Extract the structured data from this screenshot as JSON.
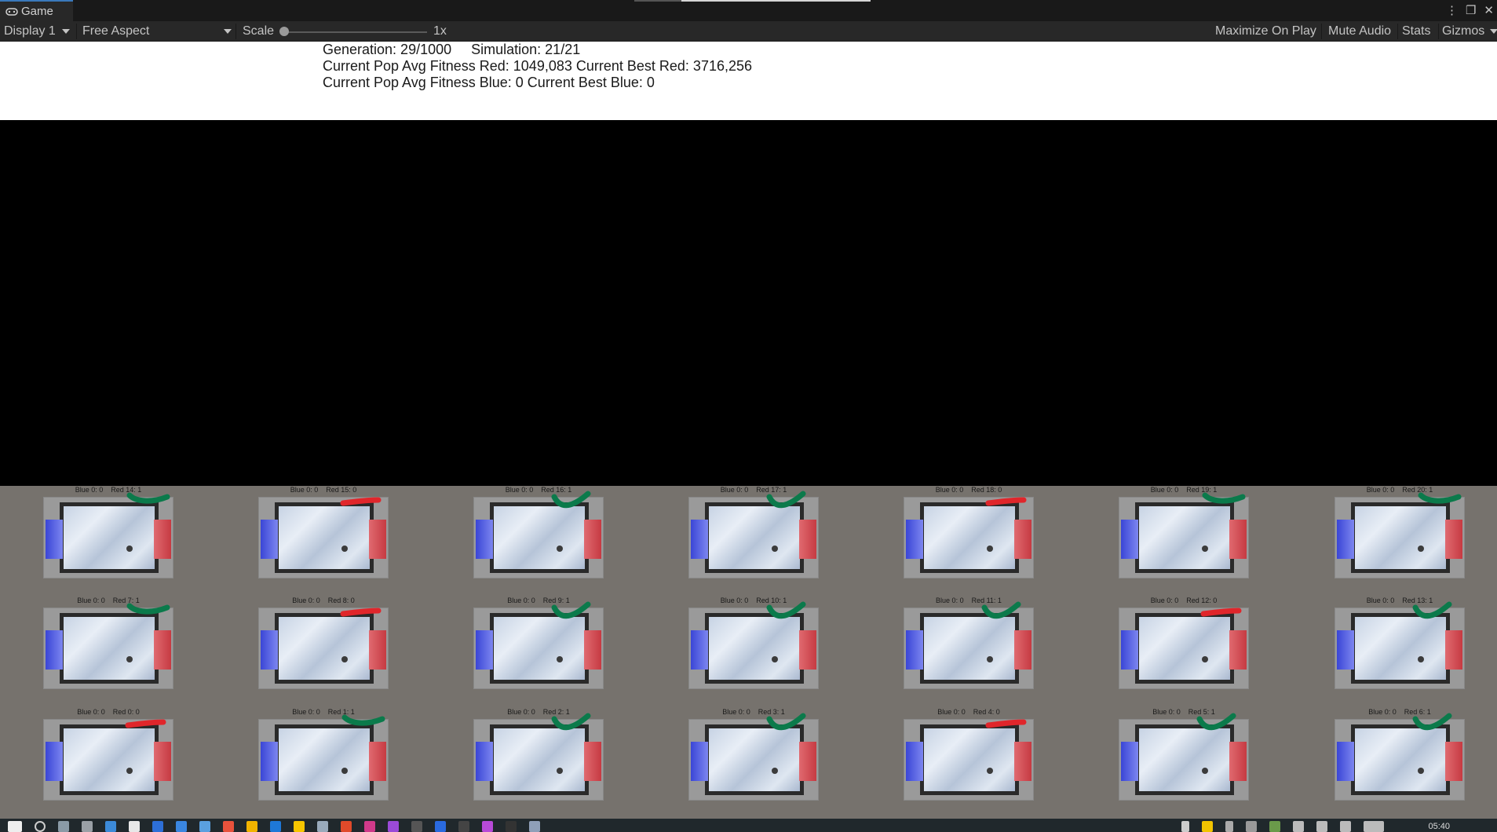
{
  "tab": {
    "title": "Game",
    "icon": "gamepad-icon"
  },
  "toolbar": {
    "display": "Display 1",
    "aspect": "Free Aspect",
    "scale_label": "Scale",
    "scale_value": "1x",
    "scale_slider_fraction": 0.0,
    "buttons": [
      "Maximize On Play",
      "Mute Audio",
      "Stats",
      "Gizmos"
    ]
  },
  "hud": {
    "line1": "Generation: 29/1000     Simulation: 21/21",
    "line2": "Current Pop Avg Fitness Red: 1049,083 Current Best Red: 3716,256",
    "line3": "Current Pop Avg Fitness Blue: 0 Current Best Blue: 0"
  },
  "simulations": {
    "rows": [
      [
        "Blue 0: 0    Red 14: 1",
        "Blue 0: 0    Red 15: 0",
        "Blue 0: 0    Red 16: 1",
        "Blue 0: 0    Red 17: 1",
        "Blue 0: 0    Red 18: 0",
        "Blue 0: 0    Red 19: 1",
        "Blue 0: 0    Red 20: 1"
      ],
      [
        "Blue 0: 0    Red 7: 1",
        "Blue 0: 0    Red 8: 0",
        "Blue 0: 0    Red 9: 1",
        "Blue 0: 0    Red 10: 1",
        "Blue 0: 0    Red 11: 1",
        "Blue 0: 0    Red 12: 0",
        "Blue 0: 0    Red 13: 1"
      ],
      [
        "Blue 0: 0    Red 0: 0",
        "Blue 0: 0    Red 1: 1",
        "Blue 0: 0    Red 2: 1",
        "Blue 0: 0    Red 3: 1",
        "Blue 0: 0    Red 4: 0",
        "Blue 0: 0    Red 5: 1",
        "Blue 0: 0    Red 6: 1"
      ]
    ],
    "mark_colors": {
      "pass": "#0b7a4b",
      "fail": "#e0262b"
    }
  },
  "colors": {
    "editor_bg": "#282828",
    "tab_accent": "#3a79bb",
    "grid_bg": "#76726d"
  },
  "taskbar": {
    "time": "05:40"
  }
}
